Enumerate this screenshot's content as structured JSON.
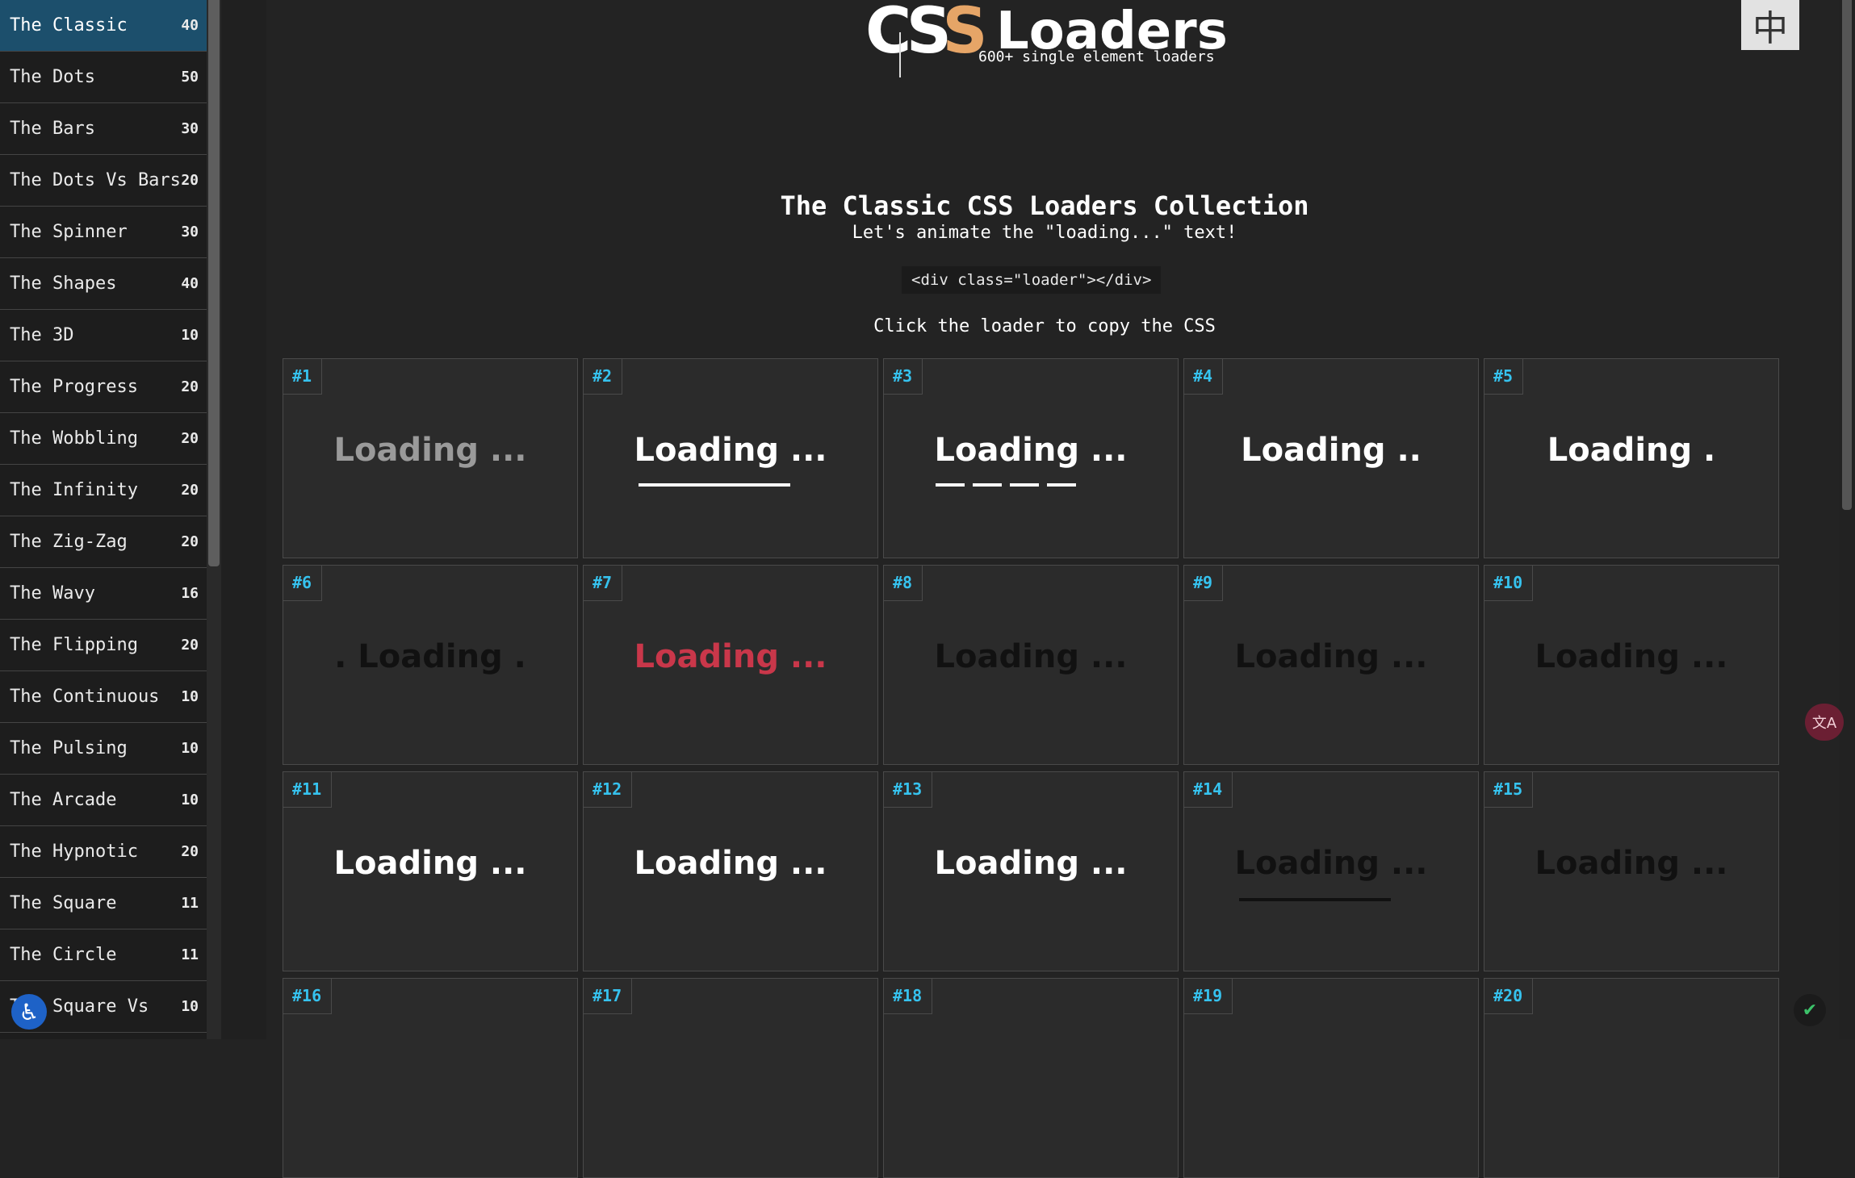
{
  "sidebar": {
    "items": [
      {
        "label": "The Classic",
        "count": "40"
      },
      {
        "label": "The Dots",
        "count": "50"
      },
      {
        "label": "The Bars",
        "count": "30"
      },
      {
        "label": "The Dots Vs Bars",
        "count": "20"
      },
      {
        "label": "The Spinner",
        "count": "30"
      },
      {
        "label": "The Shapes",
        "count": "40"
      },
      {
        "label": "The 3D",
        "count": "10"
      },
      {
        "label": "The Progress",
        "count": "20"
      },
      {
        "label": "The Wobbling",
        "count": "20"
      },
      {
        "label": "The Infinity",
        "count": "20"
      },
      {
        "label": "The Zig-Zag",
        "count": "20"
      },
      {
        "label": "The Wavy",
        "count": "16"
      },
      {
        "label": "The Flipping",
        "count": "20"
      },
      {
        "label": "The Continuous",
        "count": "10"
      },
      {
        "label": "The Pulsing",
        "count": "10"
      },
      {
        "label": "The Arcade",
        "count": "10"
      },
      {
        "label": "The Hypnotic",
        "count": "20"
      },
      {
        "label": "The Square",
        "count": "11"
      },
      {
        "label": "The Circle",
        "count": "11"
      },
      {
        "label": "The Square Vs",
        "count": "10"
      }
    ],
    "active_index": 0
  },
  "logo": {
    "css_c": "C",
    "css_s1": "S",
    "css_s2": "S",
    "title": "Loaders",
    "subtitle": "600+ single element loaders"
  },
  "lang_button": "中",
  "heading": "The Classic CSS Loaders Collection",
  "subheading": "Let's animate the \"loading...\" text!",
  "code_snippet": "<div class=\"loader\"></div>",
  "hint": "Click the loader to copy the CSS",
  "cards": [
    {
      "num": "#1",
      "text": "Loading ...",
      "color": "#9a9a9a"
    },
    {
      "num": "#2",
      "text": "Loading ...",
      "color": "#ffffff"
    },
    {
      "num": "#3",
      "text": "Loading ...",
      "color": "#ffffff"
    },
    {
      "num": "#4",
      "text": "Loading ..",
      "color": "#ffffff"
    },
    {
      "num": "#5",
      "text": "Loading .",
      "color": "#ffffff"
    },
    {
      "num": "#6",
      "text": ". Loading .",
      "color": "#111111"
    },
    {
      "num": "#7",
      "text": "Loading ...",
      "color": "#c9374a"
    },
    {
      "num": "#8",
      "text": "Loading ...",
      "color": "#111111"
    },
    {
      "num": "#9",
      "text": "Loading ...",
      "color": "#111111"
    },
    {
      "num": "#10",
      "text": "Loading ...",
      "color": "#111111"
    },
    {
      "num": "#11",
      "text": "Loading ...",
      "color": "#ffffff"
    },
    {
      "num": "#12",
      "text": "Loading ...",
      "color": "#ffffff"
    },
    {
      "num": "#13",
      "text": "Loading ...",
      "color": "#ffffff"
    },
    {
      "num": "#14",
      "text": "Loading ...",
      "color": "#111111"
    },
    {
      "num": "#15",
      "text": "Loading ...",
      "color": "#111111"
    },
    {
      "num": "#16",
      "text": "",
      "color": "#ffffff"
    },
    {
      "num": "#17",
      "text": "",
      "color": "#ffffff"
    },
    {
      "num": "#18",
      "text": "",
      "color": "#ffffff"
    },
    {
      "num": "#19",
      "text": "",
      "color": "#ffffff"
    },
    {
      "num": "#20",
      "text": "",
      "color": "#ffffff"
    }
  ],
  "icons": {
    "accessibility": "accessibility-icon",
    "translate": "translate-icon",
    "shield": "shield-check-icon"
  },
  "colors": {
    "background": "#232323",
    "sidebar_active": "#1c4f6c",
    "card_number": "#36c2ee",
    "logo_accent": "#e6a567"
  }
}
